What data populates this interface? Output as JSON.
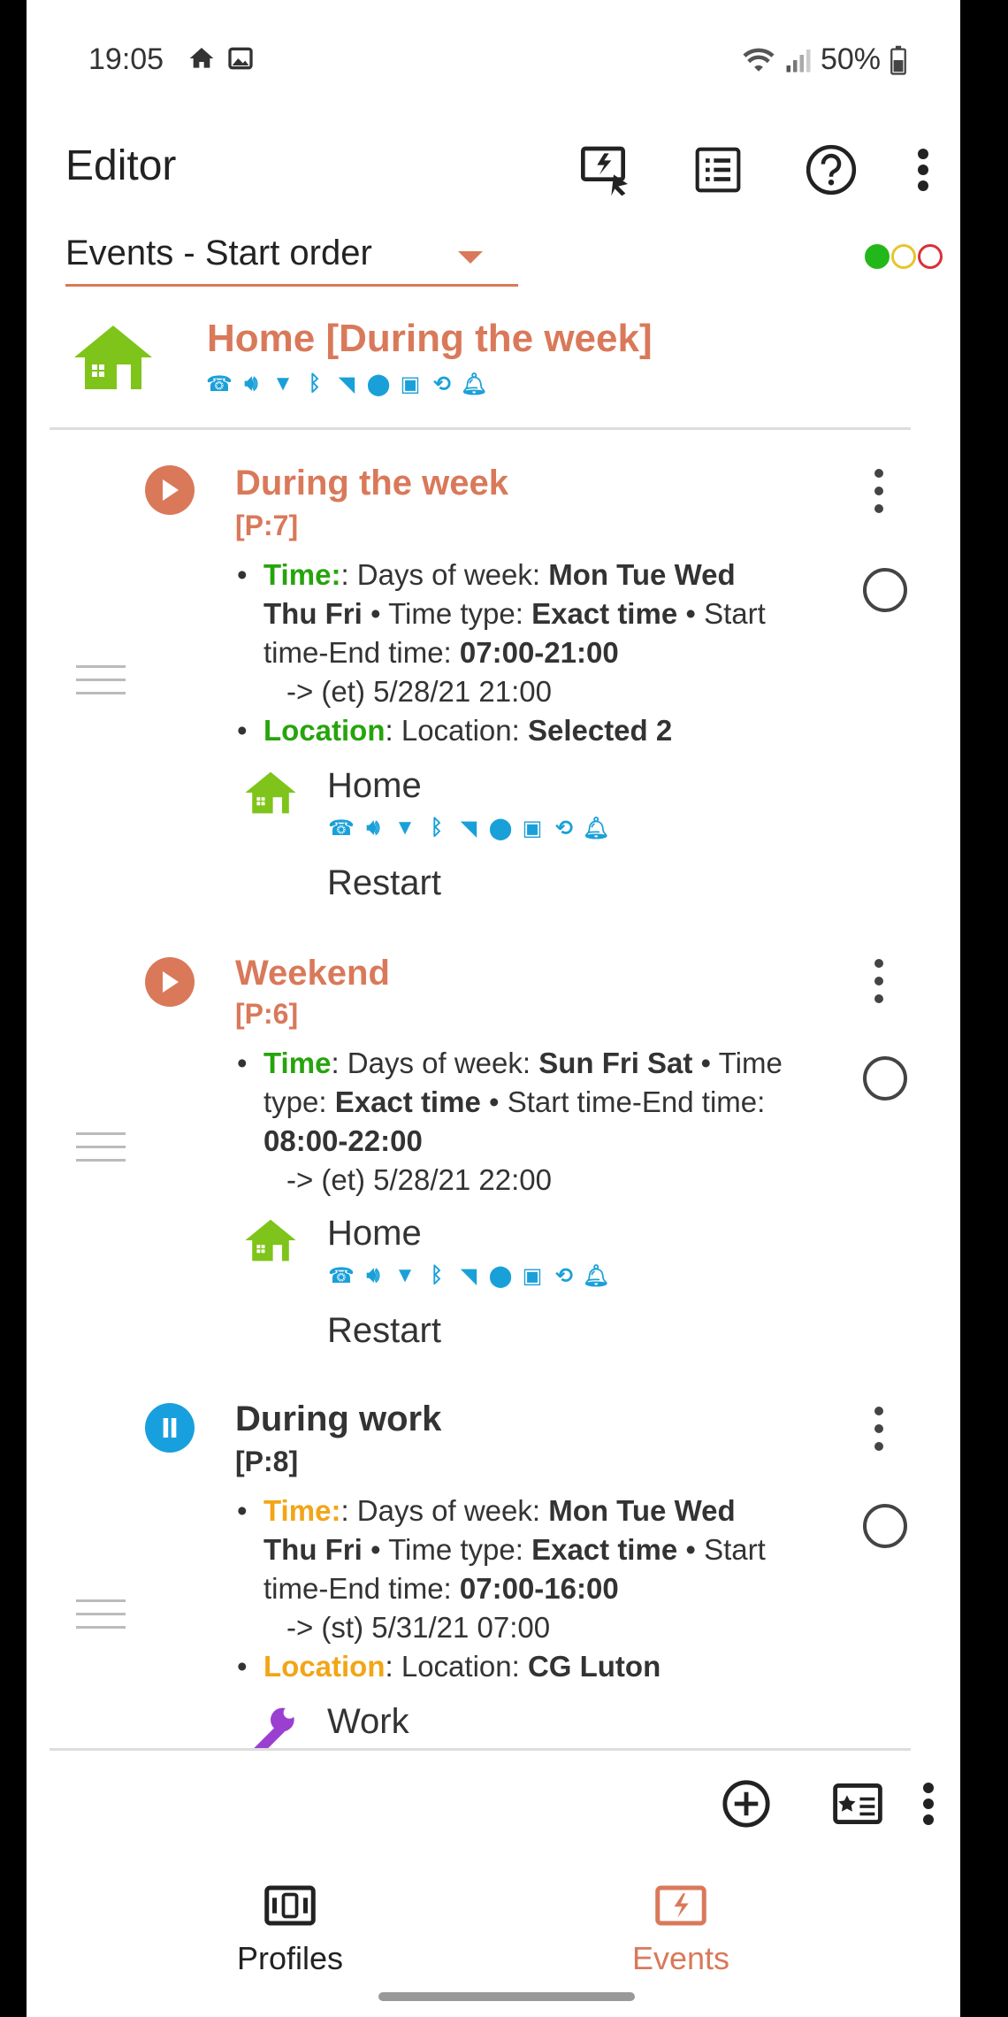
{
  "status_bar": {
    "time": "19:05",
    "battery": "50%"
  },
  "app_bar": {
    "title": "Editor"
  },
  "spinner": {
    "selected": "Events - Start order"
  },
  "active_profile": {
    "name": "Home [During the week]"
  },
  "events": [
    {
      "name": "During the week",
      "priority": "[P:7]",
      "state": "running",
      "time_label": "Time",
      "time_text_1": ": Days of week: ",
      "days": "Mon Tue Wed Thu Fri",
      "time_text_2": " • Time type: ",
      "time_type": "Exact time",
      "time_text_3": " • Start time-End time: ",
      "range": "07:00-21:00",
      "hint": "-> (et) 5/28/21 21:00",
      "location_label": "Location",
      "location_text": ": Location: ",
      "location_value": "Selected 2",
      "profile": "Home",
      "action": "Restart"
    },
    {
      "name": "Weekend",
      "priority": "[P:6]",
      "state": "running",
      "time_label": "Time",
      "time_text_1": ": Days of week: ",
      "days": "Sun Fri Sat",
      "time_text_2": " • Time type: ",
      "time_type": "Exact time",
      "time_text_3": " • Start time-End time: ",
      "range": "08:00-22:00",
      "hint": "-> (et) 5/28/21 22:00",
      "profile": "Home",
      "action": "Restart"
    },
    {
      "name": "During work",
      "priority": "[P:8]",
      "state": "paused",
      "time_label": "Time",
      "time_text_1": ": Days of week: ",
      "days": "Mon Tue Wed Thu Fri",
      "time_text_2": " • Time type: ",
      "time_type": "Exact time",
      "time_text_3": " • Start time-End time: ",
      "range": "07:00-16:00",
      "hint": "-> (st) 5/31/21 07:00",
      "location_label": "Location",
      "location_text": ": Location: ",
      "location_value": "CG Luton",
      "profile": "Work"
    }
  ],
  "bottom_nav": {
    "profiles": "Profiles",
    "events": "Events"
  },
  "colors": {
    "accent": "#d9795a",
    "green": "#27a40c",
    "orange": "#f2a516",
    "blue": "#1aa0d8",
    "house": "#7fc41a",
    "work": "#9b3fd1"
  }
}
